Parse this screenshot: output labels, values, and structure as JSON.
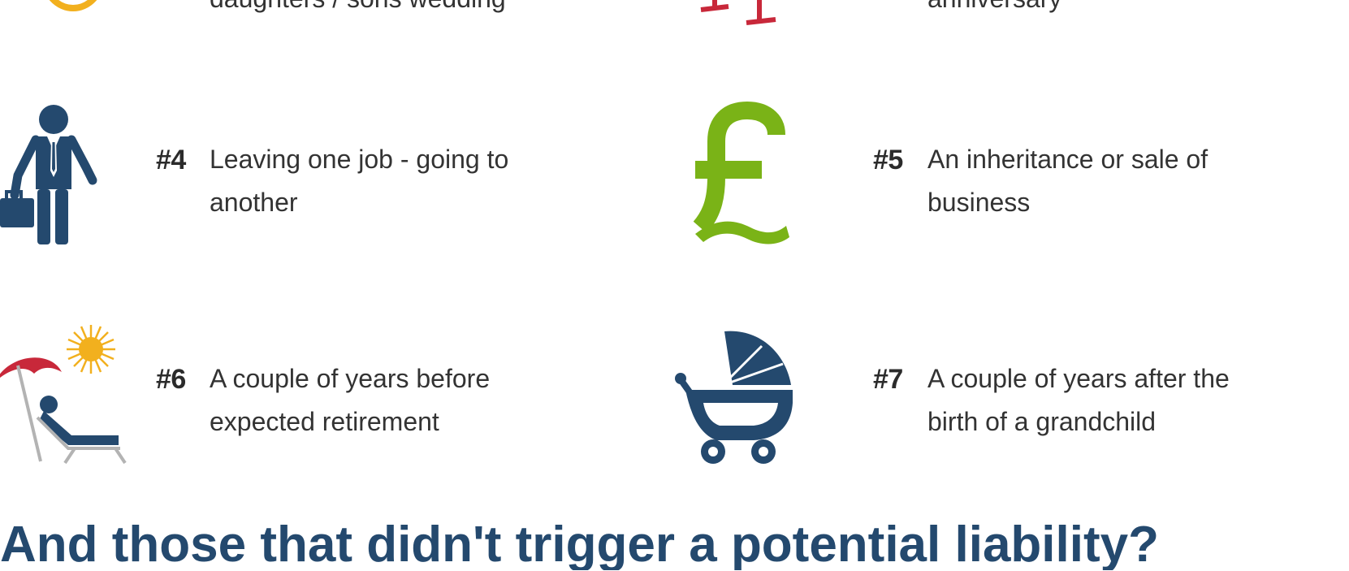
{
  "top_partial": {
    "left_text": "daughters / sons wedding",
    "right_text": "anniversary"
  },
  "items": [
    {
      "number": "#4",
      "line1": "Leaving one job - going to",
      "line2": "another",
      "icon": "businessman-icon"
    },
    {
      "number": "#5",
      "line1": "An inheritance or sale of",
      "line2": "business",
      "icon": "pound-sign-icon"
    },
    {
      "number": "#6",
      "line1": "A couple of years before",
      "line2": "expected retirement",
      "icon": "beach-lounger-icon"
    },
    {
      "number": "#7",
      "line1": "A couple of years after the",
      "line2": "birth of a grandchild",
      "icon": "pram-icon"
    }
  ],
  "bottom_heading": "And those that didn't trigger a potential liability?",
  "colors": {
    "navy": "#24496e",
    "green": "#7ab317",
    "red": "#c8283a",
    "gold": "#f2b01e",
    "text": "#333333"
  }
}
